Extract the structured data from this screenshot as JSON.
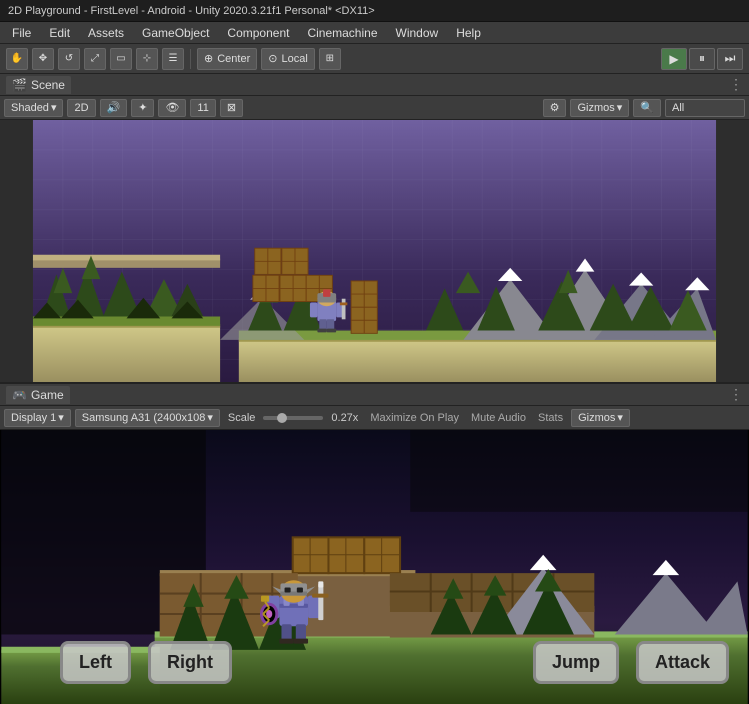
{
  "titleBar": {
    "text": "2D Playground - FirstLevel - Android - Unity 2020.3.21f1 Personal* <DX11>"
  },
  "menuBar": {
    "items": [
      "File",
      "Edit",
      "Assets",
      "GameObject",
      "Component",
      "Cinemachine",
      "Window",
      "Help"
    ]
  },
  "toolbar": {
    "tools": [
      "hand",
      "move",
      "rotate",
      "scale",
      "rect",
      "transform",
      "pivot"
    ],
    "centerLabel": "Center",
    "localLabel": "Local",
    "gridIcon": "⊞",
    "playLabel": "▶",
    "pauseLabel": "⏸",
    "stepLabel": "⏭"
  },
  "scenePanel": {
    "tabLabel": "Scene",
    "tabIcon": "🎬",
    "shaderLabel": "Shaded",
    "modeLabel": "2D",
    "gizmosLabel": "Gizmos",
    "allLabel": "All",
    "searchPlaceholder": "All"
  },
  "gamePanel": {
    "tabLabel": "Game",
    "tabIcon": "🎮",
    "displayLabel": "Display 1",
    "resolutionLabel": "Samsung A31 (2400x108",
    "scaleLabel": "Scale",
    "scaleValue": "0.27x",
    "maximizeLabel": "Maximize On Play",
    "muteLabel": "Mute Audio",
    "statsLabel": "Stats",
    "gizmosLabel": "Gizmos"
  },
  "gameButtons": {
    "leftLabel": "Left",
    "rightLabel": "Right",
    "jumpLabel": "Jump",
    "attackLabel": "Attack"
  },
  "colors": {
    "accent": "#4CAF50",
    "bg": "#3c3c3c",
    "panelBg": "#2d2d2d",
    "headerBg": "#3c3c3c"
  }
}
